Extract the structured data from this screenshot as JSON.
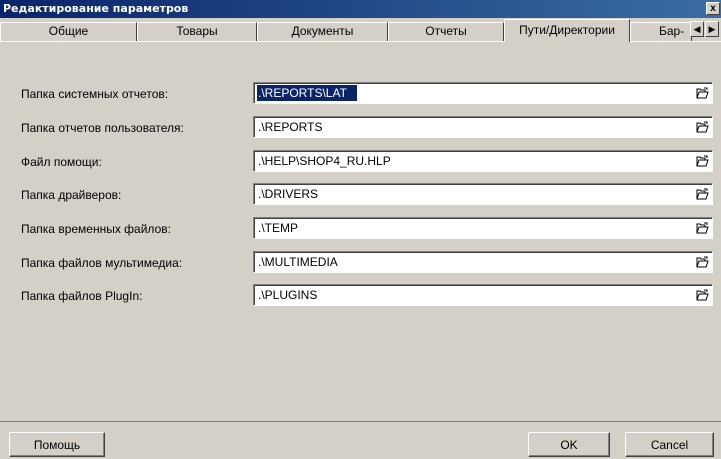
{
  "window": {
    "title": "Редактирование параметров",
    "close_label": "x"
  },
  "tabs": [
    {
      "label": "Общие",
      "active": false
    },
    {
      "label": "Товары",
      "active": false
    },
    {
      "label": "Документы",
      "active": false
    },
    {
      "label": "Отчеты",
      "active": false
    },
    {
      "label": "Пути/Директории",
      "active": true
    },
    {
      "label": "Бар-",
      "active": false
    }
  ],
  "tab_scroll": {
    "left": "◀",
    "right": "▶"
  },
  "fields": [
    {
      "label": "Папка системных отчетов:",
      "value": ".\\REPORTS\\LAT",
      "selected": true
    },
    {
      "label": "Папка отчетов пользователя:",
      "value": ".\\REPORTS",
      "selected": false
    },
    {
      "label": "Файл помощи:",
      "value": ".\\HELP\\SHOP4_RU.HLP",
      "selected": false
    },
    {
      "label": "Папка драйверов:",
      "value": ".\\DRIVERS",
      "selected": false
    },
    {
      "label": "Папка временных файлов:",
      "value": ".\\TEMP",
      "selected": false
    },
    {
      "label": "Папка файлов мультимедиа:",
      "value": ".\\MULTIMEDIA",
      "selected": false
    },
    {
      "label": "Папка файлов PlugIn:",
      "value": ".\\PLUGINS",
      "selected": false
    }
  ],
  "buttons": {
    "help": "Помощь",
    "ok": "OK",
    "cancel": "Cancel"
  },
  "icons": {
    "browse": "folder-open-icon"
  }
}
